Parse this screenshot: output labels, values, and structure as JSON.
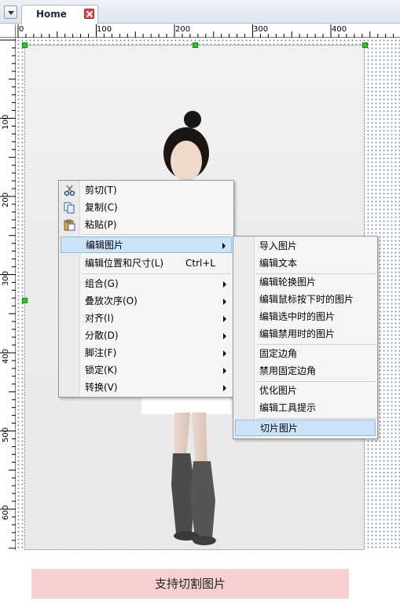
{
  "tab": {
    "title": "Home"
  },
  "ruler": {
    "h_labels": [
      "0",
      "100",
      "200",
      "300",
      "400"
    ],
    "v_labels": [
      "100",
      "200",
      "300",
      "400",
      "500",
      "600"
    ]
  },
  "menu": {
    "items": [
      {
        "label": "剪切(T)",
        "icon": "scissors-icon"
      },
      {
        "label": "复制(C)",
        "icon": "copy-icon"
      },
      {
        "label": "粘贴(P)",
        "icon": "paste-icon"
      },
      {
        "label": "编辑图片",
        "submenu": true,
        "highlighted": true
      },
      {
        "label": "编辑位置和尺寸(L)",
        "shortcut": "Ctrl+L"
      },
      {
        "label": "组合(G)",
        "submenu": true
      },
      {
        "label": "叠放次序(O)",
        "submenu": true
      },
      {
        "label": "对齐(I)",
        "submenu": true
      },
      {
        "label": "分散(D)",
        "submenu": true
      },
      {
        "label": "脚注(F)",
        "submenu": true
      },
      {
        "label": "锁定(K)",
        "submenu": true
      },
      {
        "label": "转换(V)",
        "submenu": true
      }
    ]
  },
  "submenu": {
    "items": [
      {
        "label": "导入图片"
      },
      {
        "label": "编辑文本"
      },
      {
        "label": "编辑轮换图片"
      },
      {
        "label": "编辑鼠标按下时的图片"
      },
      {
        "label": "编辑选中时的图片"
      },
      {
        "label": "编辑禁用时的图片"
      },
      {
        "label": "固定边角"
      },
      {
        "label": "禁用固定边角"
      },
      {
        "label": "优化图片"
      },
      {
        "label": "编辑工具提示"
      },
      {
        "label": "切片图片",
        "highlighted": true
      }
    ]
  },
  "caption": "支持切割图片",
  "colors": {
    "menu_highlight": "#cce3f7",
    "caption_bg": "#f7d0d2",
    "selection": "#22cc22"
  }
}
